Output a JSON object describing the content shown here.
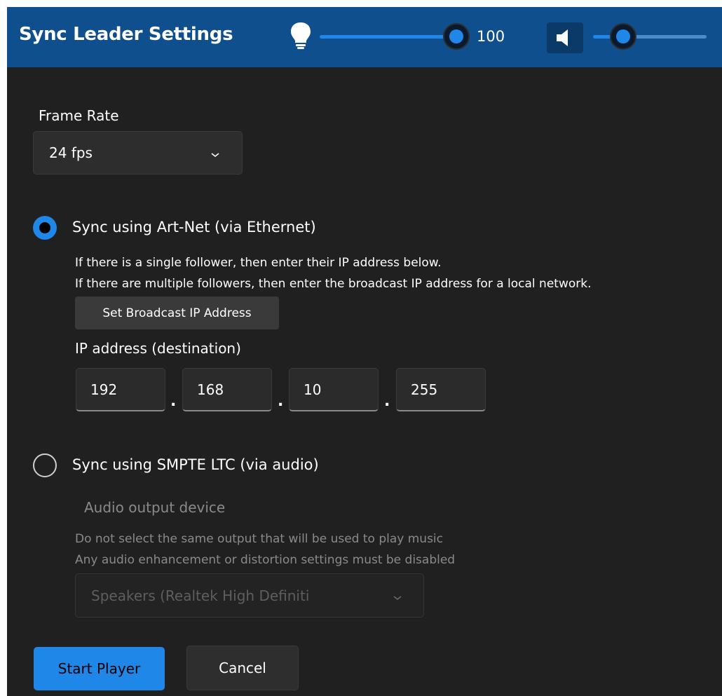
{
  "window": {
    "title": "Sync Leader Settings",
    "accent_color": "#1f87e8",
    "titlebar_color": "#0f4f8d"
  },
  "header": {
    "brightness_icon": "lightbulb-icon",
    "brightness_value": "100",
    "brightness_level": 1.0,
    "volume_icon": "speaker-icon",
    "volume_level": 0.25
  },
  "frame_rate": {
    "label": "Frame Rate",
    "selected": "24 fps"
  },
  "artnet": {
    "label": "Sync using Art-Net  (via Ethernet)",
    "selected": true,
    "help_line1": "If there is a single follower, then enter their IP address below.",
    "help_line2": "If there are multiple followers, then enter the broadcast IP address for a local network.",
    "broadcast_button": "Set Broadcast IP Address",
    "ip_label": "IP address (destination)",
    "ip_octets": [
      "192",
      "168",
      "10",
      "255"
    ],
    "ip_separator": "."
  },
  "smpte": {
    "label": "Sync using SMPTE LTC (via audio)",
    "selected": false,
    "device_label": "Audio output device",
    "help_line1": "Do not select the same output that will be used to play music",
    "help_line2": "Any audio enhancement or distortion settings must be disabled",
    "device_selected": "Speakers (Realtek High Definiti"
  },
  "actions": {
    "start_label": "Start Player",
    "cancel_label": "Cancel"
  }
}
